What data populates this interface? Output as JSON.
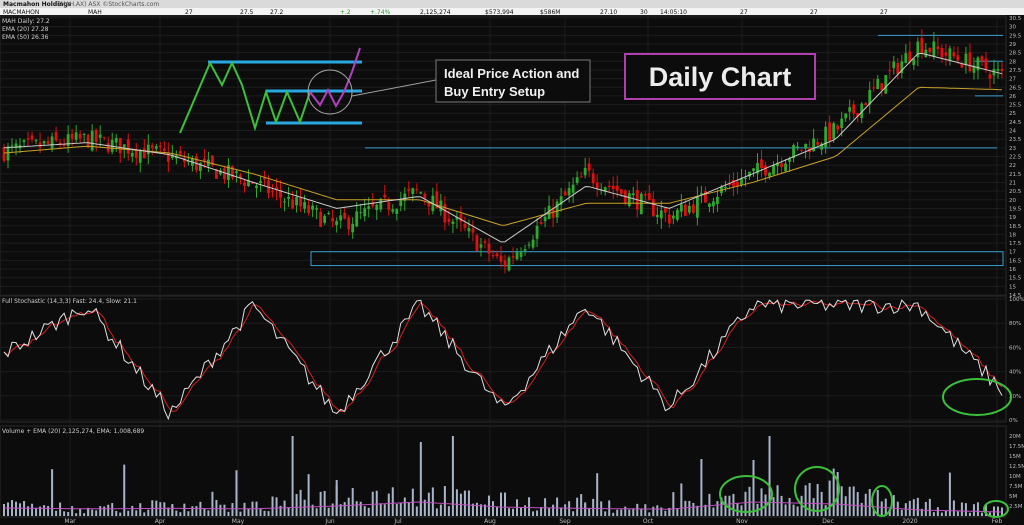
{
  "header": {
    "title": "Macmahon Holdings",
    "subtitle": "(MAH.AX) ASX  ©StockCharts.com",
    "symbol": "MACMAHON",
    "ticker": "MAH",
    "cells": [
      "27",
      "27.5",
      "27.2",
      "+.2",
      "+.74%",
      "2,125,274",
      "$573,994",
      "$586M",
      "27.10",
      "30",
      "14:05:10",
      "27",
      "27",
      "27"
    ]
  },
  "price_panel": {
    "legend": [
      "MAH Daily: 27.2",
      "EMA (20) 27.28",
      "EMA (50) 26.36"
    ],
    "title_box": "Daily Chart",
    "annotation": [
      "Ideal Price Action and",
      "Buy Entry Setup"
    ]
  },
  "stoch_panel": {
    "legend": "Full Stochastic (14,3,3) Fast: 24.4, Slow: 21.1"
  },
  "volume_panel": {
    "legend": "Volume + EMA (20) 2,125,274, EMA: 1,008,689"
  },
  "colors": {
    "background": "#0c0c0c",
    "up_candle": "#2fa82f",
    "down_candle": "#e01010",
    "ema20": "#cdcdcd",
    "ema50": "#c9a227",
    "stoch_fast": "#e0e0e0",
    "stoch_slow": "#d42020",
    "volume_bar": "#a8b4c8",
    "volume_ema": "#c04fc0",
    "level_line": "#3aa0d0",
    "annotation_green": "#3cc03c",
    "title_border": "#b040b0",
    "setup_blue": "#28a8e0"
  },
  "chart_data": [
    {
      "type": "line",
      "title": "Daily Chart",
      "x_ticks": [
        "Mar",
        "Apr",
        "May",
        "Jun",
        "Jul",
        "Aug",
        "Sep",
        "Oct",
        "Nov",
        "Dec",
        "2020",
        "Feb"
      ],
      "ylim": [
        14.5,
        30.5
      ],
      "y_ticks": [
        14.5,
        15,
        15.5,
        16,
        16.5,
        17,
        17.5,
        18,
        18.5,
        19,
        19.5,
        20,
        20.5,
        21,
        21.5,
        22,
        22.5,
        23,
        23.5,
        24,
        24.5,
        25,
        25.5,
        26,
        26.5,
        27,
        27.5,
        28,
        28.5,
        29,
        29.5,
        30,
        30.5
      ],
      "series": [
        {
          "name": "MAH Daily",
          "x": [
            "Feb",
            "Mar",
            "Apr",
            "May",
            "Jun",
            "Jul",
            "Aug",
            "Sep",
            "Oct",
            "Nov",
            "Dec",
            "2020",
            "Feb"
          ],
          "y": [
            22.8,
            23.5,
            22.5,
            21.0,
            18.5,
            20.5,
            16.2,
            21.5,
            19.0,
            21.5,
            24.0,
            29.0,
            27.2
          ]
        },
        {
          "name": "EMA (20)",
          "x": [
            "Feb",
            "Mar",
            "Apr",
            "May",
            "Jun",
            "Jul",
            "Aug",
            "Sep",
            "Oct",
            "Nov",
            "Dec",
            "2020",
            "Feb"
          ],
          "y": [
            23.0,
            23.3,
            22.6,
            21.0,
            19.5,
            20.2,
            17.5,
            20.8,
            19.5,
            21.5,
            23.5,
            28.5,
            27.28
          ]
        },
        {
          "name": "EMA (50)",
          "x": [
            "Feb",
            "Mar",
            "Apr",
            "May",
            "Jun",
            "Jul",
            "Aug",
            "Sep",
            "Oct",
            "Nov",
            "Dec",
            "2020",
            "Feb"
          ],
          "y": [
            22.7,
            23.1,
            22.7,
            21.5,
            20.0,
            20.0,
            18.5,
            19.8,
            19.8,
            21.0,
            22.5,
            26.5,
            26.36
          ]
        }
      ],
      "levels": [
        16.2,
        17.0,
        23.0,
        26.0,
        28.0,
        29.5
      ]
    },
    {
      "type": "line",
      "title": "Full Stochastic (14,3,3)",
      "ylim": [
        0,
        100
      ],
      "y_ticks": [
        "0%",
        "20%",
        "40%",
        "60%",
        "80%",
        "100%"
      ],
      "series": [
        {
          "name": "Fast",
          "x": [
            "Feb",
            "Mar",
            "Apr",
            "May",
            "Jun",
            "Jul",
            "Aug",
            "Sep",
            "Oct",
            "Nov",
            "Dec",
            "2020",
            "Feb"
          ],
          "y": [
            55,
            95,
            5,
            95,
            5,
            95,
            8,
            95,
            10,
            95,
            95,
            95,
            24.4
          ]
        },
        {
          "name": "Slow",
          "x": [
            "Feb",
            "Mar",
            "Apr",
            "May",
            "Jun",
            "Jul",
            "Aug",
            "Sep",
            "Oct",
            "Nov",
            "Dec",
            "2020",
            "Feb"
          ],
          "y": [
            52,
            92,
            8,
            92,
            8,
            92,
            10,
            92,
            12,
            92,
            92,
            92,
            21.1
          ]
        }
      ]
    },
    {
      "type": "bar",
      "title": "Volume + EMA (20)",
      "y_ticks": [
        "2.5M",
        "5M",
        "7.5M",
        "10M",
        "12.5M",
        "15M",
        "17.5M",
        "20M"
      ],
      "ylim": [
        0,
        20000000
      ],
      "series": [
        {
          "name": "Volume",
          "x": [
            "Feb",
            "Mar",
            "Apr",
            "May",
            "Jun",
            "Jul",
            "Aug",
            "Sep",
            "Oct",
            "Nov",
            "Dec",
            "2020",
            "Feb"
          ],
          "y": [
            3000000,
            2000000,
            3000000,
            2500000,
            9000000,
            18500000,
            4000000,
            3000000,
            2000000,
            14000000,
            11000000,
            3000000,
            2125274
          ]
        },
        {
          "name": "EMA",
          "x": [
            "Feb",
            "Mar",
            "Apr",
            "May",
            "Jun",
            "Jul",
            "Aug",
            "Sep",
            "Oct",
            "Nov",
            "Dec",
            "2020",
            "Feb"
          ],
          "y": [
            2000000,
            1800000,
            1900000,
            1800000,
            2500000,
            3500000,
            2200000,
            1900000,
            1700000,
            3500000,
            3000000,
            1500000,
            1008689
          ]
        }
      ]
    }
  ]
}
